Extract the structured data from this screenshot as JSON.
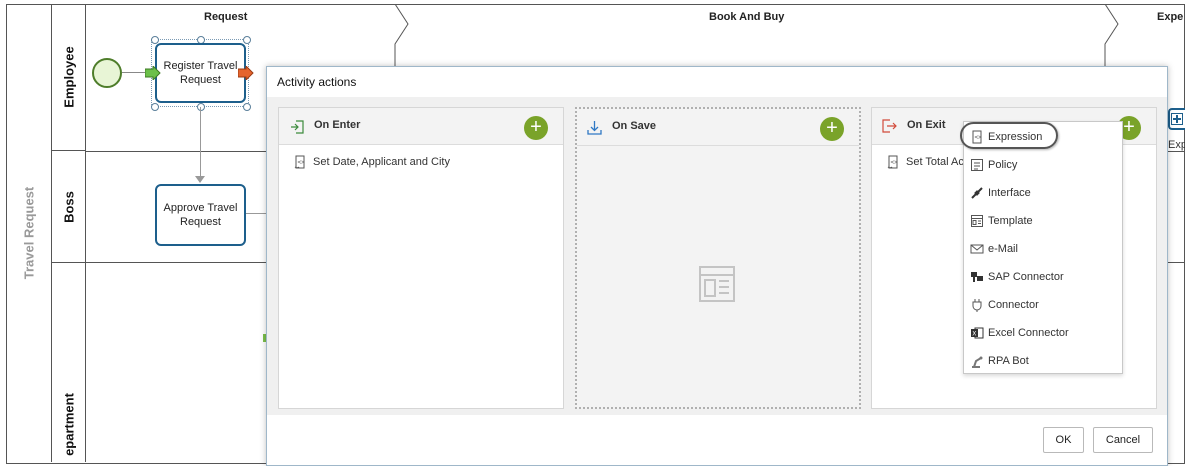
{
  "pool": {
    "label": "Travel Request"
  },
  "lanes": [
    {
      "label": "Employee"
    },
    {
      "label": "Boss"
    },
    {
      "label": "epartment"
    }
  ],
  "phases": [
    {
      "title": "Request"
    },
    {
      "title": "Book And Buy"
    },
    {
      "title": "Expe"
    }
  ],
  "tasks": {
    "register": {
      "line1": "Register Travel",
      "line2": "Request"
    },
    "approve": {
      "line1": "Approve Travel",
      "line2": "Request"
    },
    "right_partial": "Exp"
  },
  "dialog": {
    "title": "Activity actions",
    "panels": {
      "enter": {
        "title": "On Enter",
        "items": [
          "Set Date, Applicant and City"
        ]
      },
      "save": {
        "title": "On Save",
        "items": []
      },
      "exit": {
        "title": "On Exit",
        "items": [
          "Set Total Ac"
        ]
      }
    },
    "ok_label": "OK",
    "cancel_label": "Cancel"
  },
  "add_menu": {
    "items": [
      "Expression",
      "Policy",
      "Interface",
      "Template",
      "e-Mail",
      "SAP Connector",
      "Connector",
      "Excel Connector",
      "RPA Bot"
    ]
  },
  "colors": {
    "accent_green": "#7aa329",
    "task_border": "#1d5f8c",
    "highlight_ring": "#555555"
  }
}
